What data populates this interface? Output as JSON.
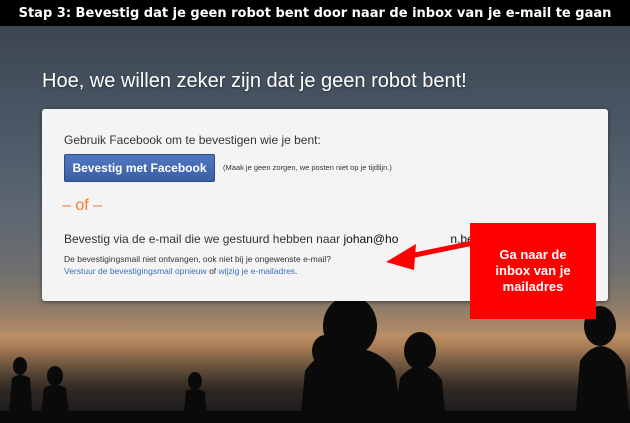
{
  "banner": {
    "text": "Stap 3: Bevestig dat je geen robot bent door naar de inbox van je e-mail te gaan"
  },
  "headline": "Hoe, we willen zeker zijn dat je geen robot bent!",
  "card": {
    "facebook_prompt": "Gebruik Facebook om te bevestigen wie je bent:",
    "facebook_button": "Bevestig met Facebook",
    "facebook_note": "(Maak je geen zorgen, we posten niet op je tijdlijn.)",
    "or_separator": "– of –",
    "email_prefix": "Bevestig via de e-mail die we gestuurd hebben naar ",
    "email_address": "johan@ho",
    "email_address_end": "n.be.",
    "not_received": "De bevestigingsmail niet ontvangen, ook niet bij je ongewenste e-mail?",
    "resend_link": "Verstuur de bevestigingsmail opnieuw",
    "or_word": " of ",
    "change_link": "wijzig je e-mailadres",
    "period": "."
  },
  "callout": {
    "text": "Ga naar de\ninbox van je\nmailadres"
  },
  "colors": {
    "facebook_blue": "#3b5fa6",
    "or_orange": "#f07e2e",
    "link_blue": "#3b6fbf",
    "callout_red": "#ff0000"
  }
}
